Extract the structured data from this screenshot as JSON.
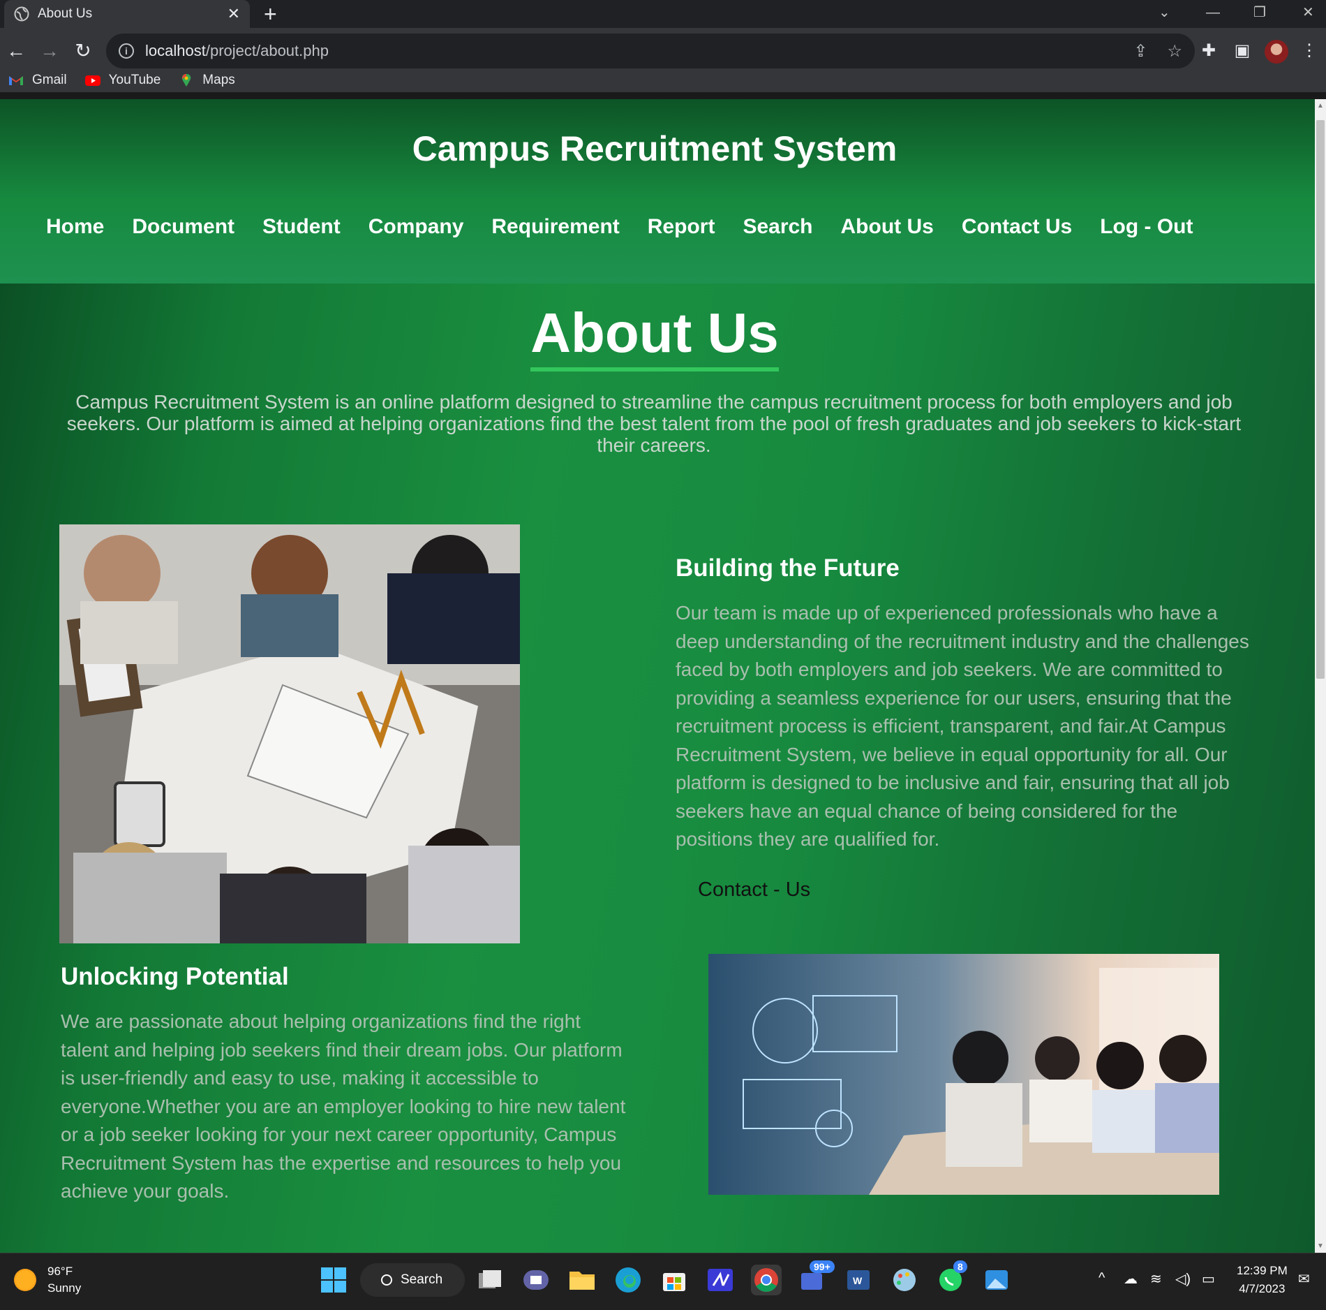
{
  "browser": {
    "tab_title": "About Us",
    "tab_close": "✕",
    "new_tab": "+",
    "url_host": "localhost",
    "url_path": "/project/about.php",
    "bookmarks": [
      {
        "label": "Gmail",
        "icon": "gmail-icon"
      },
      {
        "label": "YouTube",
        "icon": "youtube-icon"
      },
      {
        "label": "Maps",
        "icon": "maps-icon"
      }
    ]
  },
  "site": {
    "title": "Campus Recruitment System",
    "nav": [
      "Home",
      "Document",
      "Student",
      "Company",
      "Requirement",
      "Report",
      "Search",
      "About Us",
      "Contact Us",
      "Log - Out"
    ]
  },
  "about": {
    "heading": "About Us",
    "intro": "Campus Recruitment System is an online platform designed to streamline the campus recruitment process for both employers and job seekers. Our platform is aimed at helping organizations find the best talent from the pool of fresh graduates and job seekers to kick-start their careers."
  },
  "future": {
    "heading": "Building the Future",
    "text": "Our team is made up of experienced professionals who have a deep understanding of the recruitment industry and the challenges faced by both employers and job seekers. We are committed to providing a seamless experience for our users, ensuring that the recruitment process is efficient, transparent, and fair.At Campus Recruitment System, we believe in equal opportunity for all. Our platform is designed to be inclusive and fair, ensuring that all job seekers have an equal chance of being considered for the positions they are qualified for.",
    "contact_link": "Contact - Us"
  },
  "unlock": {
    "heading": "Unlocking Potential",
    "text": "We are passionate about helping organizations find the right talent and helping job seekers find their dream jobs. Our platform is user-friendly and easy to use, making it accessible to everyone.Whether you are an employer looking to hire new talent or a job seeker looking for your next career opportunity, Campus Recruitment System has the expertise and resources to help you achieve your goals."
  },
  "taskbar": {
    "temperature": "96°F",
    "condition": "Sunny",
    "search_label": "Search",
    "teams_badge": "99+",
    "whatsapp_badge": "8",
    "time": "12:39 PM",
    "date": "4/7/2023"
  },
  "colors": {
    "brand_green": "#178a3f",
    "underline_green": "#33c65c",
    "body_text": "#a9bfae"
  }
}
